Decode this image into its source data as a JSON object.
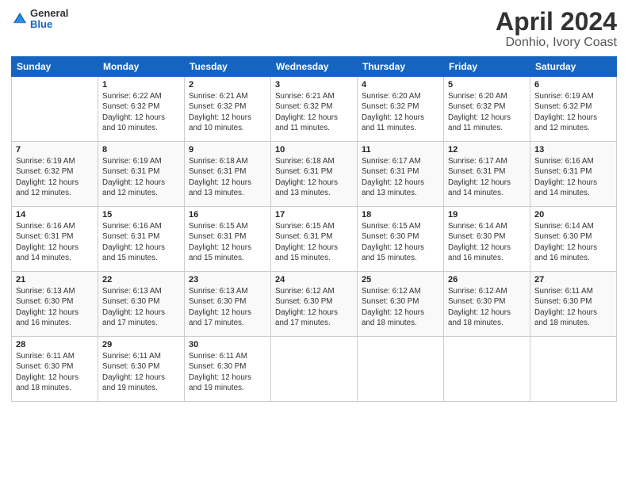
{
  "logo": {
    "general": "General",
    "blue": "Blue"
  },
  "title": "April 2024",
  "subtitle": "Donhio, Ivory Coast",
  "days_of_week": [
    "Sunday",
    "Monday",
    "Tuesday",
    "Wednesday",
    "Thursday",
    "Friday",
    "Saturday"
  ],
  "weeks": [
    [
      {
        "day": "",
        "info": ""
      },
      {
        "day": "1",
        "info": "Sunrise: 6:22 AM\nSunset: 6:32 PM\nDaylight: 12 hours\nand 10 minutes."
      },
      {
        "day": "2",
        "info": "Sunrise: 6:21 AM\nSunset: 6:32 PM\nDaylight: 12 hours\nand 10 minutes."
      },
      {
        "day": "3",
        "info": "Sunrise: 6:21 AM\nSunset: 6:32 PM\nDaylight: 12 hours\nand 11 minutes."
      },
      {
        "day": "4",
        "info": "Sunrise: 6:20 AM\nSunset: 6:32 PM\nDaylight: 12 hours\nand 11 minutes."
      },
      {
        "day": "5",
        "info": "Sunrise: 6:20 AM\nSunset: 6:32 PM\nDaylight: 12 hours\nand 11 minutes."
      },
      {
        "day": "6",
        "info": "Sunrise: 6:19 AM\nSunset: 6:32 PM\nDaylight: 12 hours\nand 12 minutes."
      }
    ],
    [
      {
        "day": "7",
        "info": "Sunrise: 6:19 AM\nSunset: 6:32 PM\nDaylight: 12 hours\nand 12 minutes."
      },
      {
        "day": "8",
        "info": "Sunrise: 6:19 AM\nSunset: 6:31 PM\nDaylight: 12 hours\nand 12 minutes."
      },
      {
        "day": "9",
        "info": "Sunrise: 6:18 AM\nSunset: 6:31 PM\nDaylight: 12 hours\nand 13 minutes."
      },
      {
        "day": "10",
        "info": "Sunrise: 6:18 AM\nSunset: 6:31 PM\nDaylight: 12 hours\nand 13 minutes."
      },
      {
        "day": "11",
        "info": "Sunrise: 6:17 AM\nSunset: 6:31 PM\nDaylight: 12 hours\nand 13 minutes."
      },
      {
        "day": "12",
        "info": "Sunrise: 6:17 AM\nSunset: 6:31 PM\nDaylight: 12 hours\nand 14 minutes."
      },
      {
        "day": "13",
        "info": "Sunrise: 6:16 AM\nSunset: 6:31 PM\nDaylight: 12 hours\nand 14 minutes."
      }
    ],
    [
      {
        "day": "14",
        "info": "Sunrise: 6:16 AM\nSunset: 6:31 PM\nDaylight: 12 hours\nand 14 minutes."
      },
      {
        "day": "15",
        "info": "Sunrise: 6:16 AM\nSunset: 6:31 PM\nDaylight: 12 hours\nand 15 minutes."
      },
      {
        "day": "16",
        "info": "Sunrise: 6:15 AM\nSunset: 6:31 PM\nDaylight: 12 hours\nand 15 minutes."
      },
      {
        "day": "17",
        "info": "Sunrise: 6:15 AM\nSunset: 6:31 PM\nDaylight: 12 hours\nand 15 minutes."
      },
      {
        "day": "18",
        "info": "Sunrise: 6:15 AM\nSunset: 6:30 PM\nDaylight: 12 hours\nand 15 minutes."
      },
      {
        "day": "19",
        "info": "Sunrise: 6:14 AM\nSunset: 6:30 PM\nDaylight: 12 hours\nand 16 minutes."
      },
      {
        "day": "20",
        "info": "Sunrise: 6:14 AM\nSunset: 6:30 PM\nDaylight: 12 hours\nand 16 minutes."
      }
    ],
    [
      {
        "day": "21",
        "info": "Sunrise: 6:13 AM\nSunset: 6:30 PM\nDaylight: 12 hours\nand 16 minutes."
      },
      {
        "day": "22",
        "info": "Sunrise: 6:13 AM\nSunset: 6:30 PM\nDaylight: 12 hours\nand 17 minutes."
      },
      {
        "day": "23",
        "info": "Sunrise: 6:13 AM\nSunset: 6:30 PM\nDaylight: 12 hours\nand 17 minutes."
      },
      {
        "day": "24",
        "info": "Sunrise: 6:12 AM\nSunset: 6:30 PM\nDaylight: 12 hours\nand 17 minutes."
      },
      {
        "day": "25",
        "info": "Sunrise: 6:12 AM\nSunset: 6:30 PM\nDaylight: 12 hours\nand 18 minutes."
      },
      {
        "day": "26",
        "info": "Sunrise: 6:12 AM\nSunset: 6:30 PM\nDaylight: 12 hours\nand 18 minutes."
      },
      {
        "day": "27",
        "info": "Sunrise: 6:11 AM\nSunset: 6:30 PM\nDaylight: 12 hours\nand 18 minutes."
      }
    ],
    [
      {
        "day": "28",
        "info": "Sunrise: 6:11 AM\nSunset: 6:30 PM\nDaylight: 12 hours\nand 18 minutes."
      },
      {
        "day": "29",
        "info": "Sunrise: 6:11 AM\nSunset: 6:30 PM\nDaylight: 12 hours\nand 19 minutes."
      },
      {
        "day": "30",
        "info": "Sunrise: 6:11 AM\nSunset: 6:30 PM\nDaylight: 12 hours\nand 19 minutes."
      },
      {
        "day": "",
        "info": ""
      },
      {
        "day": "",
        "info": ""
      },
      {
        "day": "",
        "info": ""
      },
      {
        "day": "",
        "info": ""
      }
    ]
  ]
}
